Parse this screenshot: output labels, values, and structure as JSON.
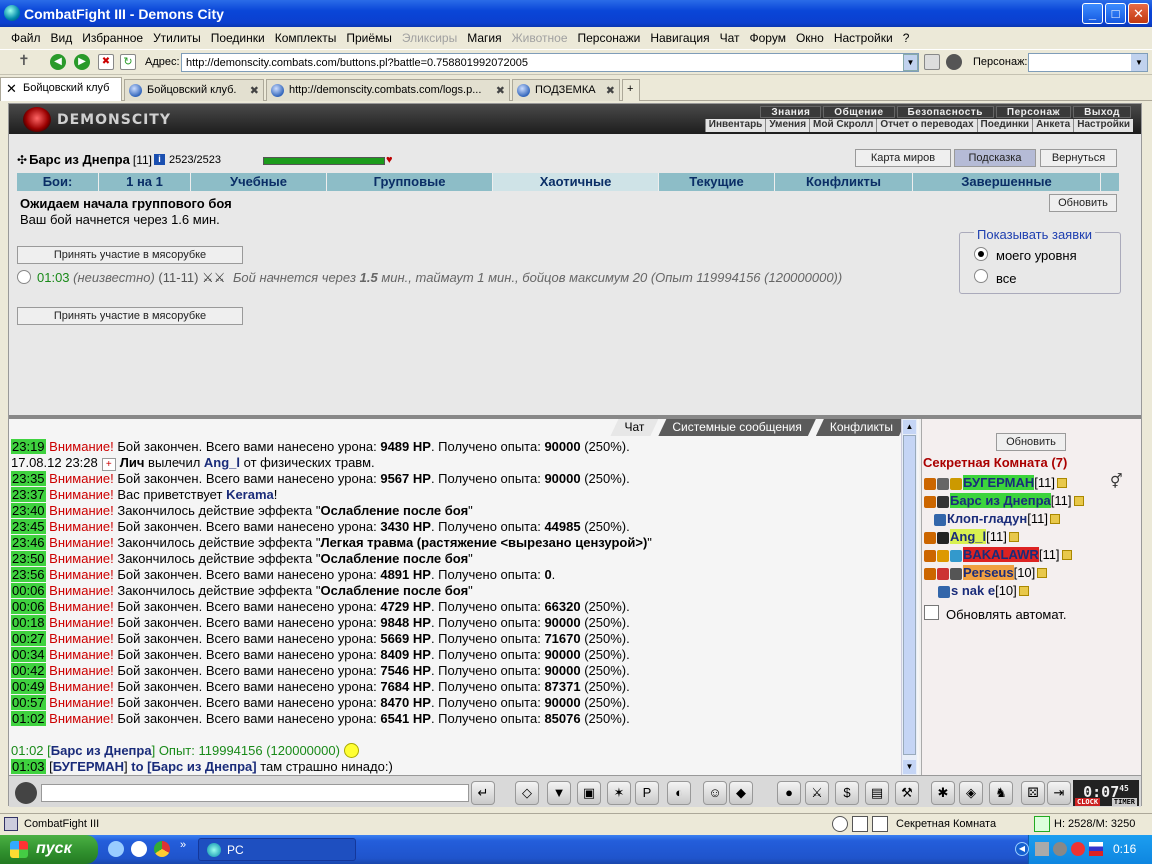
{
  "window": {
    "title": "CombatFight III - Demons City"
  },
  "menu": [
    "Файл",
    "Вид",
    "Избранное",
    "Утилиты",
    "Поединки",
    "Комплекты",
    "Приёмы",
    "Эликсиры",
    "Магия",
    "Животное",
    "Персонажи",
    "Навигация",
    "Чат",
    "Форум",
    "Окно",
    "Настройки",
    "?"
  ],
  "menu_disabled": [
    "Эликсиры",
    "Животное"
  ],
  "address": {
    "label": "Адрес:",
    "url": "http://demonscity.combats.com/buttons.pl?battle=0.758801992072005",
    "persona_label": "Персонаж:"
  },
  "tabs": [
    {
      "label": "Бойцовский клуб"
    },
    {
      "label": "Бойцовский клуб."
    },
    {
      "label": "http://demonscity.combats.com/logs.p..."
    },
    {
      "label": "ПОДЗЕМКА"
    }
  ],
  "game": {
    "logo": "DEMONSCITY",
    "nav_top": [
      "Знания",
      "Общение",
      "Безопасность",
      "Персонаж",
      "Выход"
    ],
    "nav_sub": [
      "Инвентарь",
      "Умения",
      "Мой Скролл",
      "Отчет о переводах",
      "Поединки",
      "Анкета",
      "Настройки"
    ],
    "character": {
      "name": "Барс из Днепра",
      "level": "[11]",
      "hp": "2523/2523",
      "hp_fraction": 1.0
    },
    "buttons": {
      "map": "Карта миров",
      "hint": "Подсказка",
      "back": "Вернуться",
      "refresh": "Обновить"
    },
    "fight_tabs": [
      "Бои:",
      "1 на 1",
      "Учебные",
      "Групповые",
      "Хаотичные",
      "Текущие",
      "Конфликты",
      "Завершенные"
    ],
    "fight_tab_selected": "Хаотичные",
    "waiting_title": "Ожидаем начала группового боя",
    "waiting_sub": "Ваш бой начнется через 1.6 мин.",
    "join_label": "Принять участие в мясорубке",
    "fight": {
      "time": "01:03",
      "who": "(неизвестно)",
      "levels": "(11-11)",
      "desc_a": "Бой начнется через",
      "desc_b": "1.5",
      "desc_c": "мин., таймаут 1 мин., бойцов максимум 20 (Опыт 119994156 (120000000))"
    },
    "show_box": {
      "legend": "Показывать заявки",
      "opt1": "моего уровня",
      "opt2": "все"
    }
  },
  "chat": {
    "tabs": [
      "Чат",
      "Системные сообщения",
      "Конфликты"
    ],
    "lines": [
      {
        "t": "23:19",
        "a": "Внимание!",
        "b": " Бой закончен. Всего вами нанесено урона: ",
        "c": "9489 HP",
        "d": ". Получено опыта: ",
        "e": "90000",
        "f": " (250%)."
      },
      {
        "t": "17.08.12 23:28",
        "plain": true,
        "n": "Лич",
        "b": " вылечил ",
        "c": "Ang_l",
        "d": " от физических травм.",
        "e": "",
        "f": ""
      },
      {
        "t": "23:35",
        "a": "Внимание!",
        "b": " Бой закончен. Всего вами нанесено урона: ",
        "c": "9567 HP",
        "d": ". Получено опыта: ",
        "e": "90000",
        "f": " (250%)."
      },
      {
        "t": "23:37",
        "a": "Внимание!",
        "b": " Вас приветствует ",
        "c": "Kerama",
        "d": "!",
        "e": "",
        "f": ""
      },
      {
        "t": "23:40",
        "a": "Внимание!",
        "b": " Закончилось действие эффекта \"",
        "c": "Ослабление после боя",
        "d": "\"",
        "e": "",
        "f": ""
      },
      {
        "t": "23:45",
        "a": "Внимание!",
        "b": " Бой закончен. Всего вами нанесено урона: ",
        "c": "3430 HP",
        "d": ". Получено опыта: ",
        "e": "44985",
        "f": " (250%)."
      },
      {
        "t": "23:46",
        "a": "Внимание!",
        "b": " Закончилось действие эффекта \"",
        "c": "Легкая травма (растяжение <вырезано цензурой>)",
        "d": "\"",
        "e": "",
        "f": ""
      },
      {
        "t": "23:50",
        "a": "Внимание!",
        "b": " Закончилось действие эффекта \"",
        "c": "Ослабление после боя",
        "d": "\"",
        "e": "",
        "f": ""
      },
      {
        "t": "23:56",
        "a": "Внимание!",
        "b": " Бой закончен. Всего вами нанесено урона: ",
        "c": "4891 HP",
        "d": ". Получено опыта: ",
        "e": "0",
        "f": "."
      },
      {
        "t": "00:06",
        "a": "Внимание!",
        "b": " Закончилось действие эффекта \"",
        "c": "Ослабление после боя",
        "d": "\"",
        "e": "",
        "f": ""
      },
      {
        "t": "00:06",
        "a": "Внимание!",
        "b": " Бой закончен. Всего вами нанесено урона: ",
        "c": "4729 HP",
        "d": ". Получено опыта: ",
        "e": "66320",
        "f": " (250%)."
      },
      {
        "t": "00:18",
        "a": "Внимание!",
        "b": " Бой закончен. Всего вами нанесено урона: ",
        "c": "9848 HP",
        "d": ". Получено опыта: ",
        "e": "90000",
        "f": " (250%)."
      },
      {
        "t": "00:27",
        "a": "Внимание!",
        "b": " Бой закончен. Всего вами нанесено урона: ",
        "c": "5669 HP",
        "d": ". Получено опыта: ",
        "e": "71670",
        "f": " (250%)."
      },
      {
        "t": "00:34",
        "a": "Внимание!",
        "b": " Бой закончен. Всего вами нанесено урона: ",
        "c": "8409 HP",
        "d": ". Получено опыта: ",
        "e": "90000",
        "f": " (250%)."
      },
      {
        "t": "00:42",
        "a": "Внимание!",
        "b": " Бой закончен. Всего вами нанесено урона: ",
        "c": "7546 HP",
        "d": ". Получено опыта: ",
        "e": "90000",
        "f": " (250%)."
      },
      {
        "t": "00:49",
        "a": "Внимание!",
        "b": " Бой закончен. Всего вами нанесено урона: ",
        "c": "7684 HP",
        "d": ". Получено опыта: ",
        "e": "87371",
        "f": " (250%)."
      },
      {
        "t": "00:57",
        "a": "Внимание!",
        "b": " Бой закончен. Всего вами нанесено урона: ",
        "c": "8470 HP",
        "d": ". Получено опыта: ",
        "e": "90000",
        "f": " (250%)."
      },
      {
        "t": "01:02",
        "a": "Внимание!",
        "b": " Бой закончен. Всего вами нанесено урона: ",
        "c": "6541 HP",
        "d": ". Получено опыта: ",
        "e": "85076",
        "f": " (250%)."
      }
    ],
    "exp_line": {
      "t": "01:02",
      "nick": "Барс из Днепра",
      "text": "Опыт: 119994156 (120000000)"
    },
    "last_line": {
      "t": "01:03",
      "from": "БУГЕРМАН",
      "to": "to [Барс из Днепра]",
      "text": " там страшно нинадо:)"
    }
  },
  "room": {
    "refresh": "Обновить",
    "title": "Секретная Комната (7)",
    "members": [
      {
        "name": "БУГЕРМАН",
        "lv": "[11]",
        "bg": "#3cd43c"
      },
      {
        "name": "Барс из Днепра",
        "lv": "[11]",
        "bg": "#3cd43c"
      },
      {
        "name": "Клоп-гладун",
        "lv": "[11]",
        "bg": ""
      },
      {
        "name": "Ang_l",
        "lv": "[11]",
        "bg": "#d8f050"
      },
      {
        "name": "BAKALAWR",
        "lv": "[11]",
        "bg": "#d22"
      },
      {
        "name": "Perseus",
        "lv": "[10]",
        "bg": "#f0a040"
      },
      {
        "name": "s nak e",
        "lv": "[10]",
        "bg": ""
      }
    ],
    "auto_label": "Обновлять автомат."
  },
  "clock": {
    "time": "0:07",
    "sec": "45",
    "l1": "CLOCK",
    "l2": "TIMER"
  },
  "status": {
    "left": "CombatFight III",
    "room": "Секретная Комната",
    "hm": "H: 2528/M: 3250"
  },
  "taskbar": {
    "start": "пуск",
    "app": "PC",
    "time": "0:16"
  }
}
